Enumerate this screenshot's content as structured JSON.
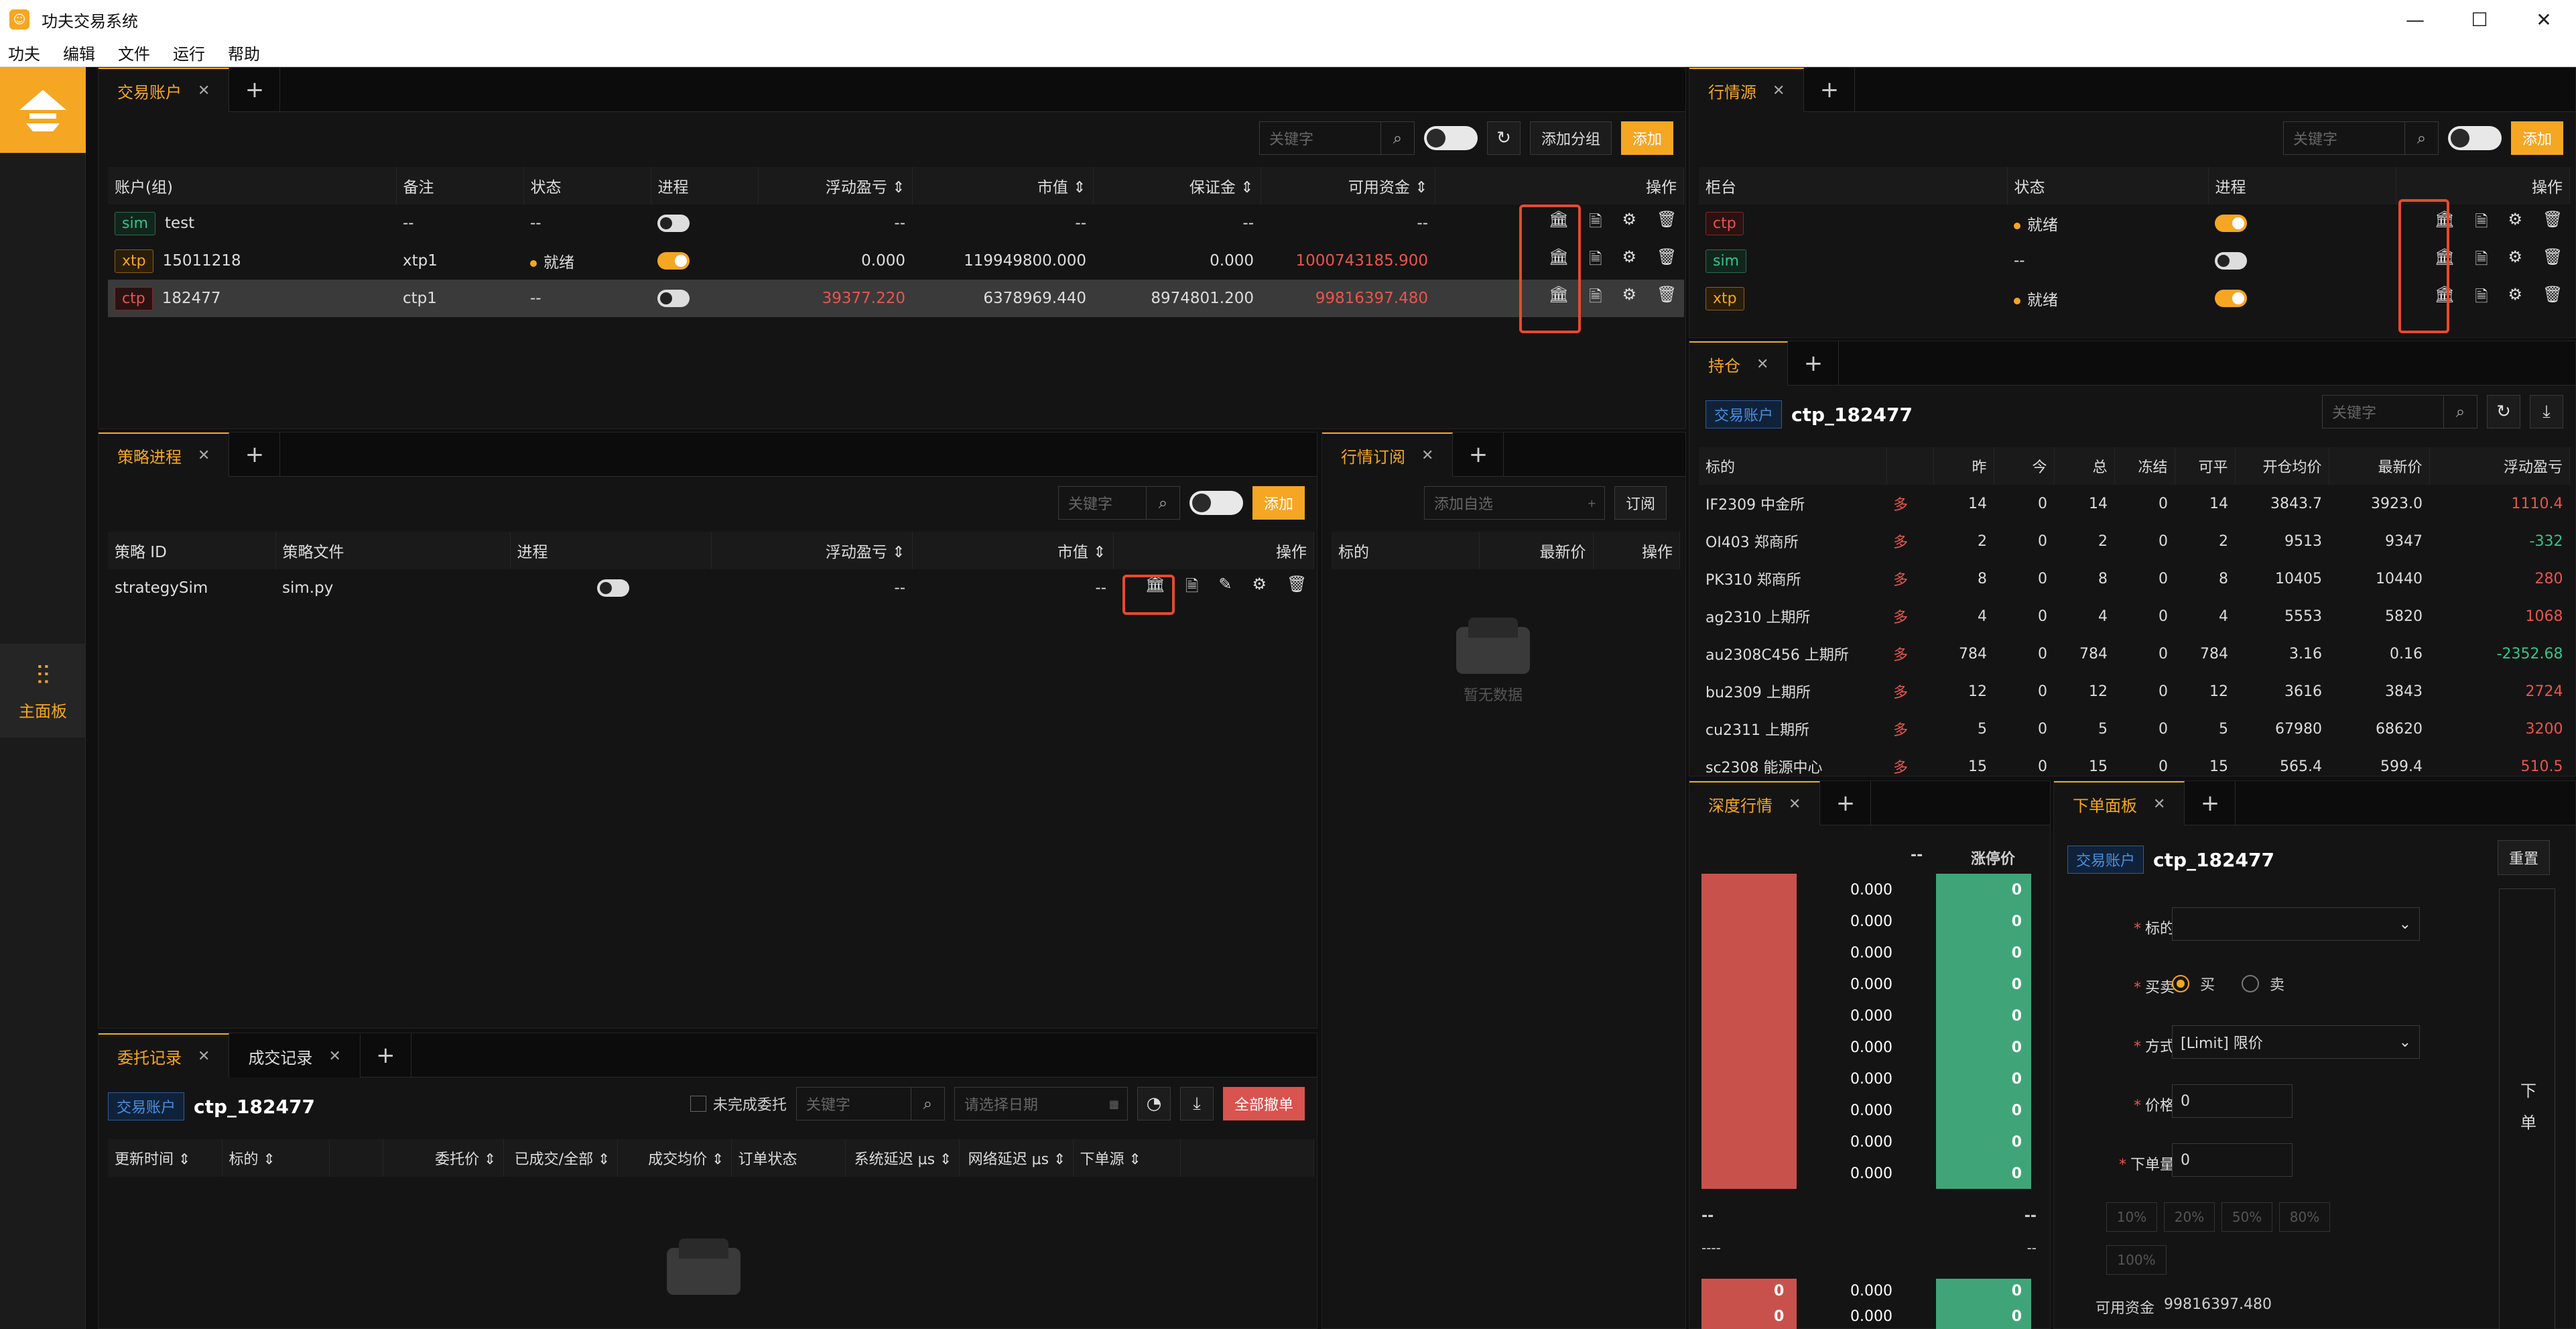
{
  "window": {
    "title": "功夫交易系统",
    "minimize": "—",
    "maximize": "☐",
    "close": "✕"
  },
  "menu": [
    "功夫",
    "编辑",
    "文件",
    "运行",
    "帮助"
  ],
  "sidebar": {
    "main_label": "主面板"
  },
  "accounts_panel": {
    "tabs": [
      {
        "label": "交易账户",
        "close": "✕"
      }
    ],
    "plus": "+",
    "search_placeholder": "关键字",
    "add_group": "添加分组",
    "add": "添加",
    "columns": [
      "账户(组)",
      "备注",
      "状态",
      "进程",
      "浮动盈亏 ⇕",
      "市值 ⇕",
      "保证金 ⇕",
      "可用资金 ⇕",
      "操作"
    ],
    "rows": [
      {
        "source": "sim",
        "account": "test",
        "remark": "--",
        "status": "--",
        "process_on": false,
        "pnl": "--",
        "market_value": "--",
        "margin": "--",
        "available": "--"
      },
      {
        "source": "xtp",
        "account": "15011218",
        "remark": "xtp1",
        "status": "就绪",
        "process_on": true,
        "pnl": "0.000",
        "market_value": "119949800.000",
        "margin": "0.000",
        "available": "1000743185.900"
      },
      {
        "source": "ctp",
        "account": "182477",
        "remark": "ctp1",
        "status": "--",
        "process_on": false,
        "pnl": "39377.220",
        "market_value": "6378969.440",
        "margin": "8974801.200",
        "available": "99816397.480"
      }
    ]
  },
  "md_source_panel": {
    "tabs": [
      {
        "label": "行情源",
        "close": "✕"
      }
    ],
    "search_placeholder": "关键字",
    "add": "添加",
    "columns": [
      "柜台",
      "状态",
      "进程",
      "操作"
    ],
    "rows": [
      {
        "source": "ctp",
        "status": "就绪",
        "process_on": true
      },
      {
        "source": "sim",
        "status": "--",
        "process_on": false
      },
      {
        "source": "xtp",
        "status": "就绪",
        "process_on": true
      }
    ]
  },
  "position_panel": {
    "tabs": [
      {
        "label": "持仓",
        "close": "✕"
      }
    ],
    "badge": "交易账户",
    "account": "ctp_182477",
    "search_placeholder": "关键字",
    "columns": [
      "标的",
      "",
      "昨",
      "今",
      "总",
      "冻结",
      "可平",
      "开仓均价",
      "最新价",
      "浮动盈亏"
    ],
    "rows": [
      {
        "symbol": "IF2309 中金所",
        "dir": "多",
        "yd": "14",
        "td": "0",
        "total": "14",
        "frozen": "0",
        "closable": "14",
        "avg": "3843.7",
        "last": "3923.0",
        "pnl": "1110.4",
        "pnl_color": "red"
      },
      {
        "symbol": "OI403 郑商所",
        "dir": "多",
        "yd": "2",
        "td": "0",
        "total": "2",
        "frozen": "0",
        "closable": "2",
        "avg": "9513",
        "last": "9347",
        "pnl": "-332",
        "pnl_color": "green"
      },
      {
        "symbol": "PK310 郑商所",
        "dir": "多",
        "yd": "8",
        "td": "0",
        "total": "8",
        "frozen": "0",
        "closable": "8",
        "avg": "10405",
        "last": "10440",
        "pnl": "280",
        "pnl_color": "red"
      },
      {
        "symbol": "ag2310 上期所",
        "dir": "多",
        "yd": "4",
        "td": "0",
        "total": "4",
        "frozen": "0",
        "closable": "4",
        "avg": "5553",
        "last": "5820",
        "pnl": "1068",
        "pnl_color": "red"
      },
      {
        "symbol": "au2308C456 上期所",
        "dir": "多",
        "yd": "784",
        "td": "0",
        "total": "784",
        "frozen": "0",
        "closable": "784",
        "avg": "3.16",
        "last": "0.16",
        "pnl": "-2352.68",
        "pnl_color": "green"
      },
      {
        "symbol": "bu2309 上期所",
        "dir": "多",
        "yd": "12",
        "td": "0",
        "total": "12",
        "frozen": "0",
        "closable": "12",
        "avg": "3616",
        "last": "3843",
        "pnl": "2724",
        "pnl_color": "red"
      },
      {
        "symbol": "cu2311 上期所",
        "dir": "多",
        "yd": "5",
        "td": "0",
        "total": "5",
        "frozen": "0",
        "closable": "5",
        "avg": "67980",
        "last": "68620",
        "pnl": "3200",
        "pnl_color": "red"
      },
      {
        "symbol": "sc2308 能源中心",
        "dir": "多",
        "yd": "15",
        "td": "0",
        "total": "15",
        "frozen": "0",
        "closable": "15",
        "avg": "565.4",
        "last": "599.4",
        "pnl": "510.5",
        "pnl_color": "red"
      }
    ]
  },
  "strategy_panel": {
    "tabs": [
      {
        "label": "策略进程",
        "close": "✕"
      }
    ],
    "search_placeholder": "关键字",
    "add": "添加",
    "columns": [
      "策略 ID",
      "策略文件",
      "进程",
      "浮动盈亏 ⇕",
      "市值 ⇕",
      "操作"
    ],
    "rows": [
      {
        "id": "strategySim",
        "file": "sim.py",
        "process_on": false,
        "pnl": "--",
        "market_value": "--"
      }
    ]
  },
  "md_sub_panel": {
    "tabs": [
      {
        "label": "行情订阅",
        "close": "✕"
      }
    ],
    "input_placeholder": "添加自选",
    "subscribe": "订阅",
    "columns": [
      "标的",
      "最新价",
      "操作"
    ],
    "empty": "暂无数据"
  },
  "orders_panel": {
    "tabs": [
      {
        "label": "委托记录",
        "close": "✕"
      },
      {
        "label": "成交记录",
        "close": "✕"
      }
    ],
    "badge": "交易账户",
    "account": "ctp_182477",
    "unfinished": "未完成委托",
    "search_placeholder": "关键字",
    "date_placeholder": "请选择日期",
    "cancel_all": "全部撤单",
    "columns": [
      "更新时间 ⇕",
      "标的 ⇕",
      "",
      "委托价 ⇕",
      "已成交/全部 ⇕",
      "成交均价 ⇕",
      "订单状态",
      "系统延迟 μs ⇕",
      "网络延迟 μs ⇕",
      "下单源 ⇕",
      ""
    ]
  },
  "depth_panel": {
    "tabs": [
      {
        "label": "深度行情",
        "close": "✕"
      }
    ],
    "header_left": "--",
    "header_right": "涨停价",
    "ask_prices": [
      "0.000",
      "0.000",
      "0.000",
      "0.000",
      "0.000",
      "0.000",
      "0.000",
      "0.000",
      "0.000",
      "0.000"
    ],
    "ask_vols": [
      "0",
      "0",
      "0",
      "0",
      "0",
      "0",
      "0",
      "0",
      "0",
      "0"
    ],
    "mid_left": "--",
    "mid_right": "--",
    "mid_left2": "----",
    "mid_right2": "--",
    "bid_prices": [
      "0.000",
      "0.000"
    ],
    "bid_vols": [
      "0",
      "0"
    ],
    "bid_vols_right": [
      "0",
      "0"
    ]
  },
  "order_panel": {
    "tabs": [
      {
        "label": "下单面板",
        "close": "✕"
      }
    ],
    "badge": "交易账户",
    "account": "ctp_182477",
    "reset": "重置",
    "symbol_label": "标的",
    "side_label": "买卖",
    "buy": "买",
    "sell": "卖",
    "mode_label": "方式",
    "mode_value": "[Limit] 限价",
    "price_label": "价格",
    "price_value": "0",
    "qty_label": "下单量",
    "qty_value": "0",
    "pcts": [
      "10%",
      "20%",
      "50%",
      "80%",
      "100%"
    ],
    "available_label": "可用资金",
    "available_value": "99816397.480",
    "submit": "下 单"
  },
  "colors": {
    "accent": "#f5a623",
    "up": "#e8554e",
    "down": "#34c58a",
    "highlight_box": "#e64a2e"
  }
}
